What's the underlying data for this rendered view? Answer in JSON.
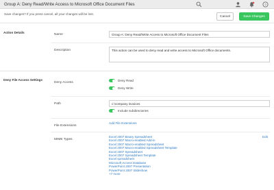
{
  "header": {
    "title": "Group A: Deny Read/Write Access to Microsoft Office Document Files"
  },
  "save_bar": {
    "message": "Save changes? If you press cancel, all your changes will be lost.",
    "cancel_label": "Cancel",
    "save_label": "Save Changes"
  },
  "action_details": {
    "section_title": "Action Details",
    "name_label": "Name",
    "name_value": "Group A: Deny Read/Write Access to Microsoft Office Document Files",
    "description_label": "Description",
    "description_value": "This action can be used to deny read and write access to Microsoft Office documents."
  },
  "deny_settings": {
    "section_title": "Deny File Access Settings",
    "deny_access_label": "Deny Access",
    "deny_read_label": "Deny Read",
    "deny_read_on": true,
    "deny_write_label": "Deny Write",
    "deny_write_on": true,
    "path_label": "Path",
    "path_value": "c:\\company invoices",
    "include_subdirs_label": "Include subdirectories",
    "include_subdirs_on": true,
    "file_ext_label": "File Extensions",
    "add_ext_label": "Add File Extensions",
    "mime_label": "MIME Types",
    "edit_label": "Edit",
    "mime_types": [
      "Excel 2007 Binary Spreadsheet",
      "Excel 2007 Macro-enabled Add-in",
      "Excel 2007 Macro-enabled Spreadsheet",
      "Excel 2007 Macro-enabled Spreadsheet Template",
      "Excel 2007 Spreadsheet",
      "Excel 2007 Spreadsheet Template",
      "Excel spreadsheet",
      "Microsoft Access Database",
      "PowerPoint 2007 Presentation",
      "PowerPoint 2007 Slideshow",
      "+7 more"
    ]
  },
  "colors": {
    "accent_green": "#3ac65f",
    "link_blue": "#2f7bc4"
  }
}
